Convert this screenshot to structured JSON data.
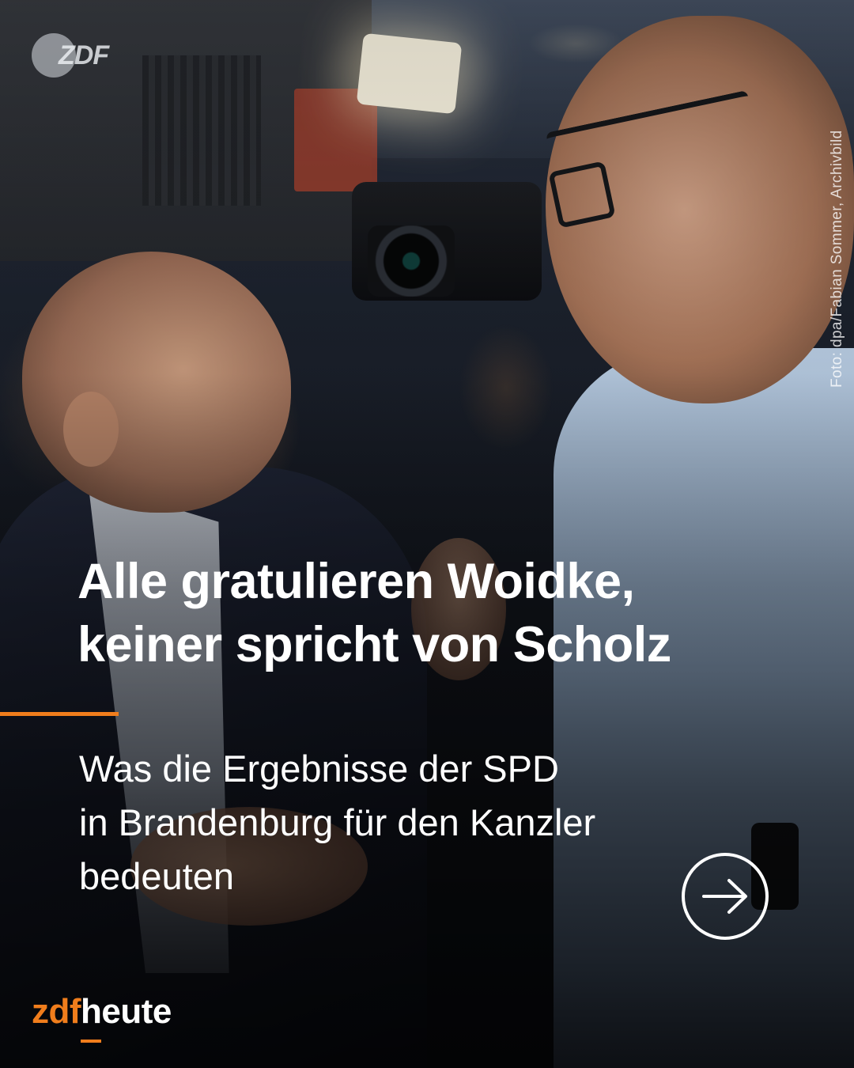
{
  "photo_credit": "Foto: dpa/Fabian Sommer, Archivbild",
  "watermark": "ZDF",
  "headline": {
    "line1": "Alle gratulieren Woidke,",
    "line2": "keiner spricht von Scholz"
  },
  "subline": {
    "line1": "Was die Ergebnisse der SPD",
    "line2": "in Brandenburg für den Kanzler",
    "line3": "bedeuten"
  },
  "arrow_icon": "arrow-right-circle-icon",
  "brand": {
    "part1": "zdf",
    "part2": "heute"
  },
  "colors": {
    "accent": "#f07d1c",
    "text": "#ffffff"
  }
}
